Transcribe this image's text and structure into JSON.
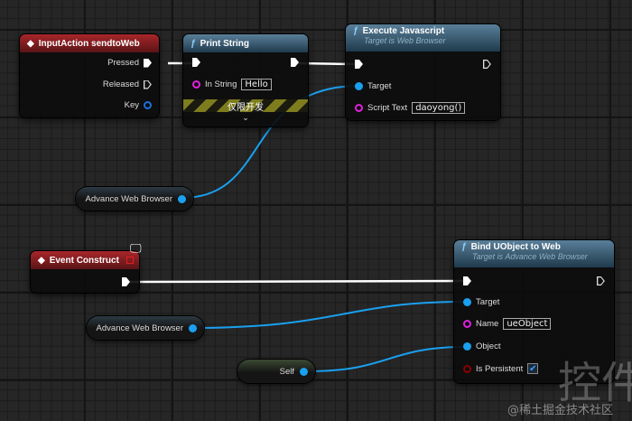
{
  "colors": {
    "event_header": "#a8262b",
    "function_header": "#3f6580",
    "object_pin": "#1aa0f0",
    "string_pin": "#e020e0",
    "bool_pin": "#8b0000",
    "exec_wire": "#ffffff"
  },
  "input_action": {
    "title": "InputAction sendtoWeb",
    "pins": {
      "pressed": "Pressed",
      "released": "Released",
      "key": "Key"
    }
  },
  "print_string": {
    "title": "Print String",
    "in_string_label": "In String",
    "in_string_value": "Hello",
    "dev_only": "仅限开发"
  },
  "execute_js": {
    "title": "Execute Javascript",
    "subtitle": "Target is Web Browser",
    "target": "Target",
    "script_label": "Script Text",
    "script_value": "daoyong()"
  },
  "var_top": {
    "label": "Advance Web Browser"
  },
  "event_construct": {
    "title": "Event Construct"
  },
  "var_bottom": {
    "label": "Advance Web Browser"
  },
  "self_node": {
    "label": "Self"
  },
  "bind_uobject": {
    "title": "Bind UObject to Web",
    "subtitle": "Target is Advance Web Browser",
    "target": "Target",
    "name_label": "Name",
    "name_value": "ueObject",
    "object": "Object",
    "persistent": "Is Persistent",
    "persistent_checked": true
  },
  "watermark": {
    "text": "@稀土掘金技术社区",
    "big": "控件"
  }
}
